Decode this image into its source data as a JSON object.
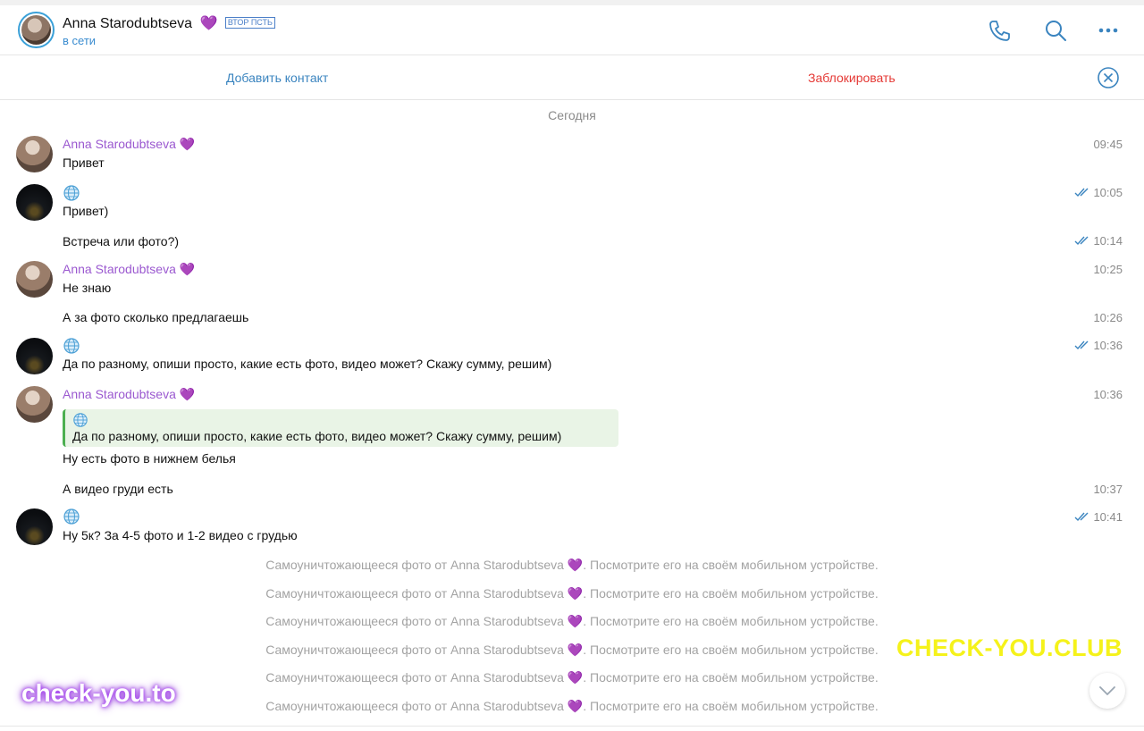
{
  "header": {
    "name": "Anna Starodubtseva",
    "heart": "💜",
    "badge": "ВТОР ПСТЬ",
    "status": "в сети",
    "icons": [
      "phone-icon",
      "search-icon",
      "more-icon"
    ]
  },
  "actions": {
    "add_contact": "Добавить контакт",
    "block": "Заблокировать"
  },
  "date_separator": "Сегодня",
  "messages": [
    {
      "sender": "Anna Starodubtseva 💜",
      "text": "Привет",
      "time": "09:45"
    },
    {
      "sender_icon": "globe-icon",
      "text": "Привет)",
      "time": "10:05",
      "read": true
    },
    {
      "text": "Встреча или фото?)",
      "time": "10:14",
      "read": true
    },
    {
      "sender": "Anna Starodubtseva 💜",
      "text": "Не знаю",
      "time": "10:25"
    },
    {
      "text": "А за фото сколько предлагаешь",
      "time": "10:26"
    },
    {
      "sender_icon": "globe-icon",
      "text": "Да по разному, опиши просто, какие есть фото, видео может? Скажу сумму, решим)",
      "time": "10:36",
      "read": true
    },
    {
      "sender": "Anna Starodubtseva 💜",
      "quote": "Да по разному, опиши просто, какие есть фото, видео может? Скажу сумму, решим)",
      "text": "Ну есть фото в нижнем белья",
      "time": "10:36"
    },
    {
      "text": "А видео груди есть",
      "time": "10:37"
    },
    {
      "sender_icon": "globe-icon",
      "text": "Ну 5к? За 4-5 фото и 1-2 видео с грудью",
      "time": "10:41",
      "read": true
    }
  ],
  "service": {
    "before": "Самоуничтожающееся фото от Anna Starodubtseva ",
    "heart": "💜",
    "after": ". Посмотрите его на своём мобильном устройстве."
  },
  "watermarks": {
    "left": "check-you.to",
    "right": "CHECK-YOU.CLUB"
  },
  "colors": {
    "accent": "#3a84bf",
    "danger": "#e53935",
    "sender": "#9b59d0",
    "quote_bg": "#e9f4e6",
    "quote_bar": "#4caf50"
  }
}
